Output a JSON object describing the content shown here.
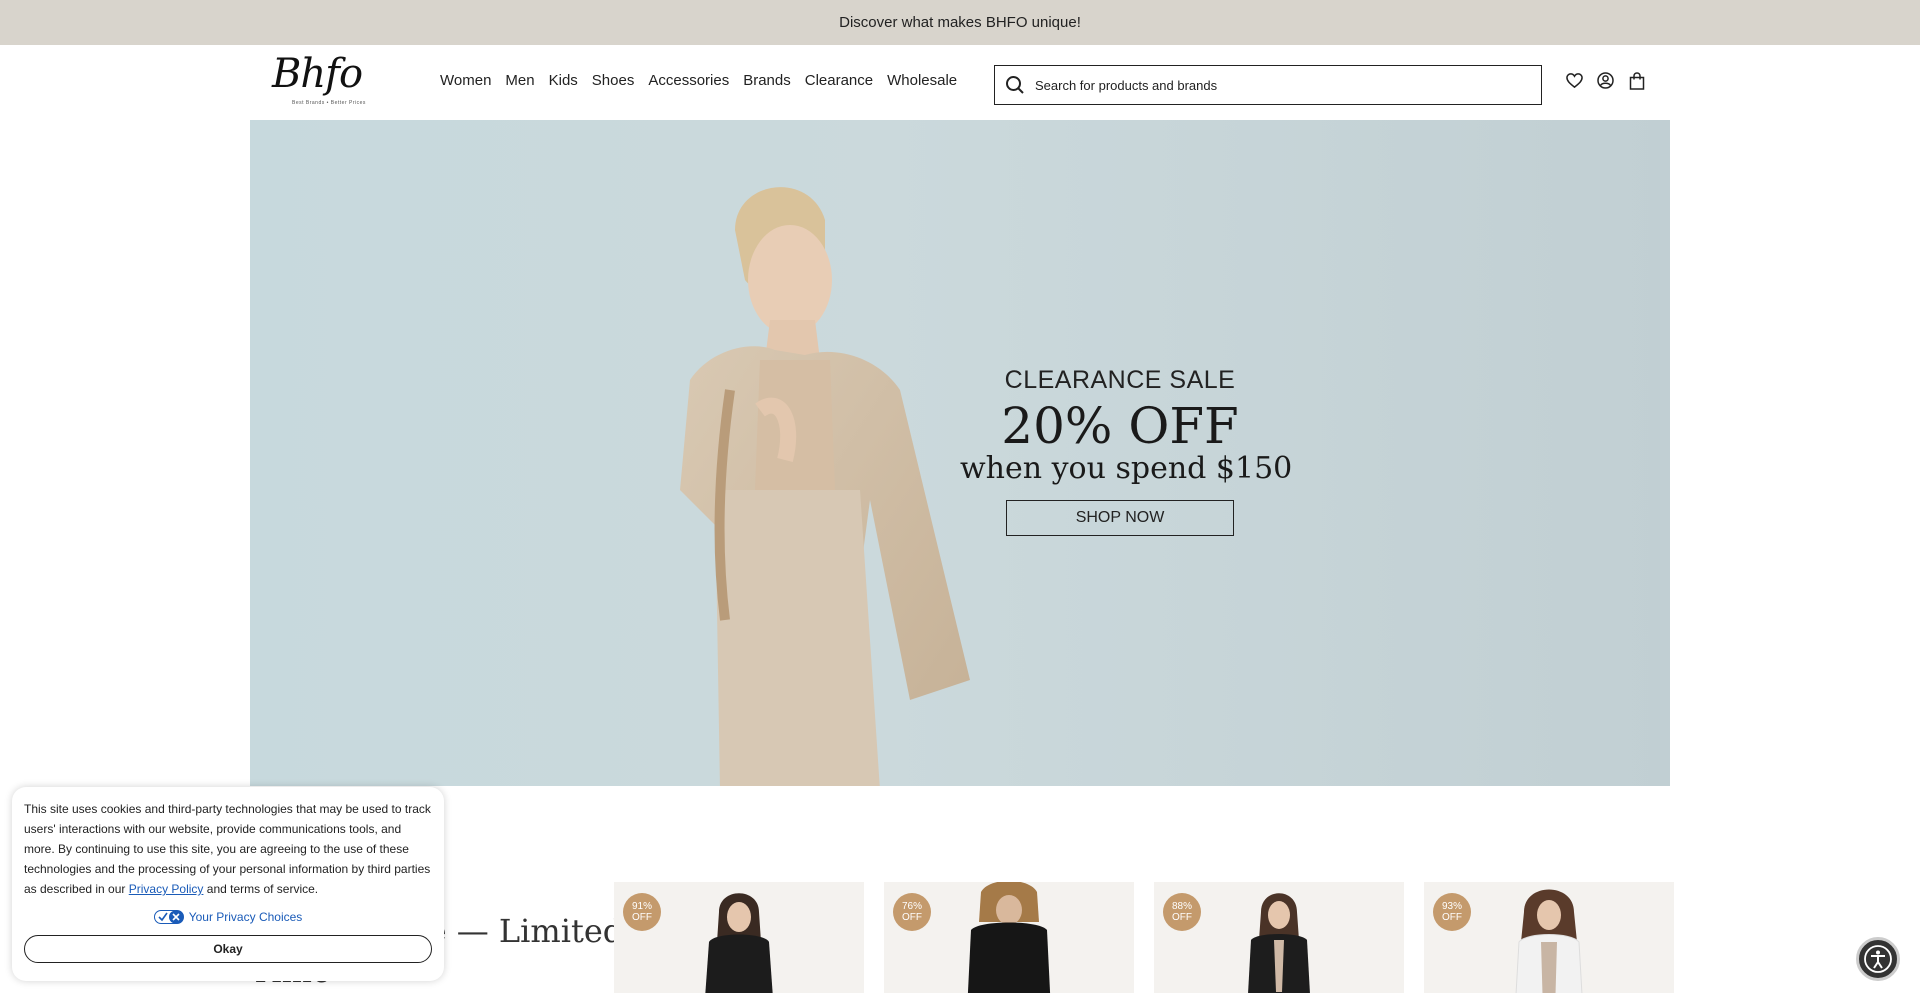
{
  "announcement": "Discover what makes BHFO unique!",
  "logo": {
    "text": "Bhfo",
    "tagline": "Best Brands • Better Prices"
  },
  "nav": [
    "Women",
    "Men",
    "Kids",
    "Shoes",
    "Accessories",
    "Brands",
    "Clearance",
    "Wholesale"
  ],
  "search": {
    "placeholder": "Search for products and brands"
  },
  "header_icons": [
    "heart-icon",
    "user-icon",
    "bag-icon"
  ],
  "hero": {
    "kicker": "CLEARANCE SALE",
    "headline": "20% OFF",
    "subline": "when you spend $150",
    "cta": "SHOP NOW"
  },
  "section": {
    "title_line1": "Season Sale — Limited",
    "title_line2": "Time"
  },
  "products": [
    {
      "percent": "91%",
      "off": "OFF"
    },
    {
      "percent": "76%",
      "off": "OFF"
    },
    {
      "percent": "88%",
      "off": "OFF"
    },
    {
      "percent": "93%",
      "off": "OFF"
    }
  ],
  "cookie": {
    "text": "This site uses cookies and third-party technologies that may be used to track users' interactions with our website, provide communications tools, and more. By continuing to use this site, you are agreeing to the use of these technologies and the processing of your personal information by third parties as described in our",
    "link": "Privacy Policy",
    "text_after": "and terms of service.",
    "privacy_choices": "Your Privacy Choices",
    "button": "Okay"
  },
  "colors": {
    "announce_bg": "#d8d4cc",
    "hero_bg": "#c7d9dd",
    "badge": "#c49a6c"
  }
}
